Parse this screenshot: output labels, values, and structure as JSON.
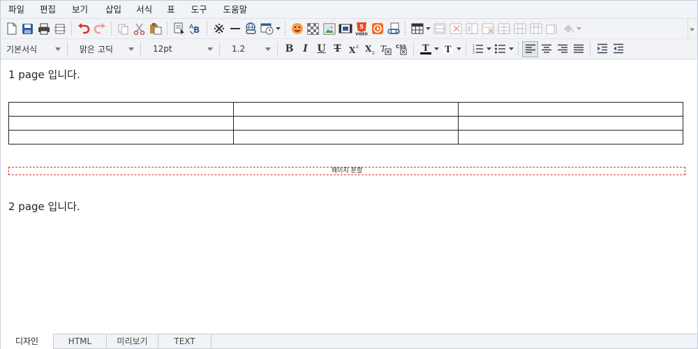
{
  "menu": [
    "파일",
    "편집",
    "보기",
    "삽입",
    "서식",
    "표",
    "도구",
    "도움말"
  ],
  "format_bar": {
    "paragraph_style": "기본서식",
    "font_family": "맑은 고딕",
    "font_size": "12pt",
    "line_height": "1.2"
  },
  "document": {
    "paragraph1": "1 page 입니다.",
    "table": {
      "rows": 3,
      "cols": 3
    },
    "page_break_label": "페이지 분할",
    "paragraph2": "2 page 입니다."
  },
  "tabs": [
    {
      "label": "디자인",
      "active": true
    },
    {
      "label": "HTML",
      "active": false
    },
    {
      "label": "미리보기",
      "active": false
    },
    {
      "label": "TEXT",
      "active": false
    }
  ],
  "icons_toolbar1": [
    "new-document-icon",
    "save-icon",
    "print-icon",
    "page-setup-icon",
    "undo-icon",
    "redo-icon",
    "copy-icon",
    "cut-icon",
    "paste-icon",
    "select-all-icon",
    "find-replace-icon",
    "special-char-icon",
    "horizontal-line-icon",
    "link-icon",
    "date-time-icon",
    "emoticon-icon",
    "background-icon",
    "image-icon",
    "media-icon",
    "video-icon",
    "flash-icon",
    "bookmark-icon",
    "table-icon",
    "cell-merge-icon",
    "cell-delete-icon",
    "cell-split-icon",
    "row-delete-icon",
    "row-insert-icon",
    "col-insert-icon",
    "col-delete-icon",
    "cell-props-icon",
    "fill-color-icon"
  ],
  "colors": {
    "accent_orange": "#f26b1d",
    "undo_red": "#d9322a",
    "page_break_red": "#dd3333",
    "toolbar_bg": "#f1f3f6"
  }
}
